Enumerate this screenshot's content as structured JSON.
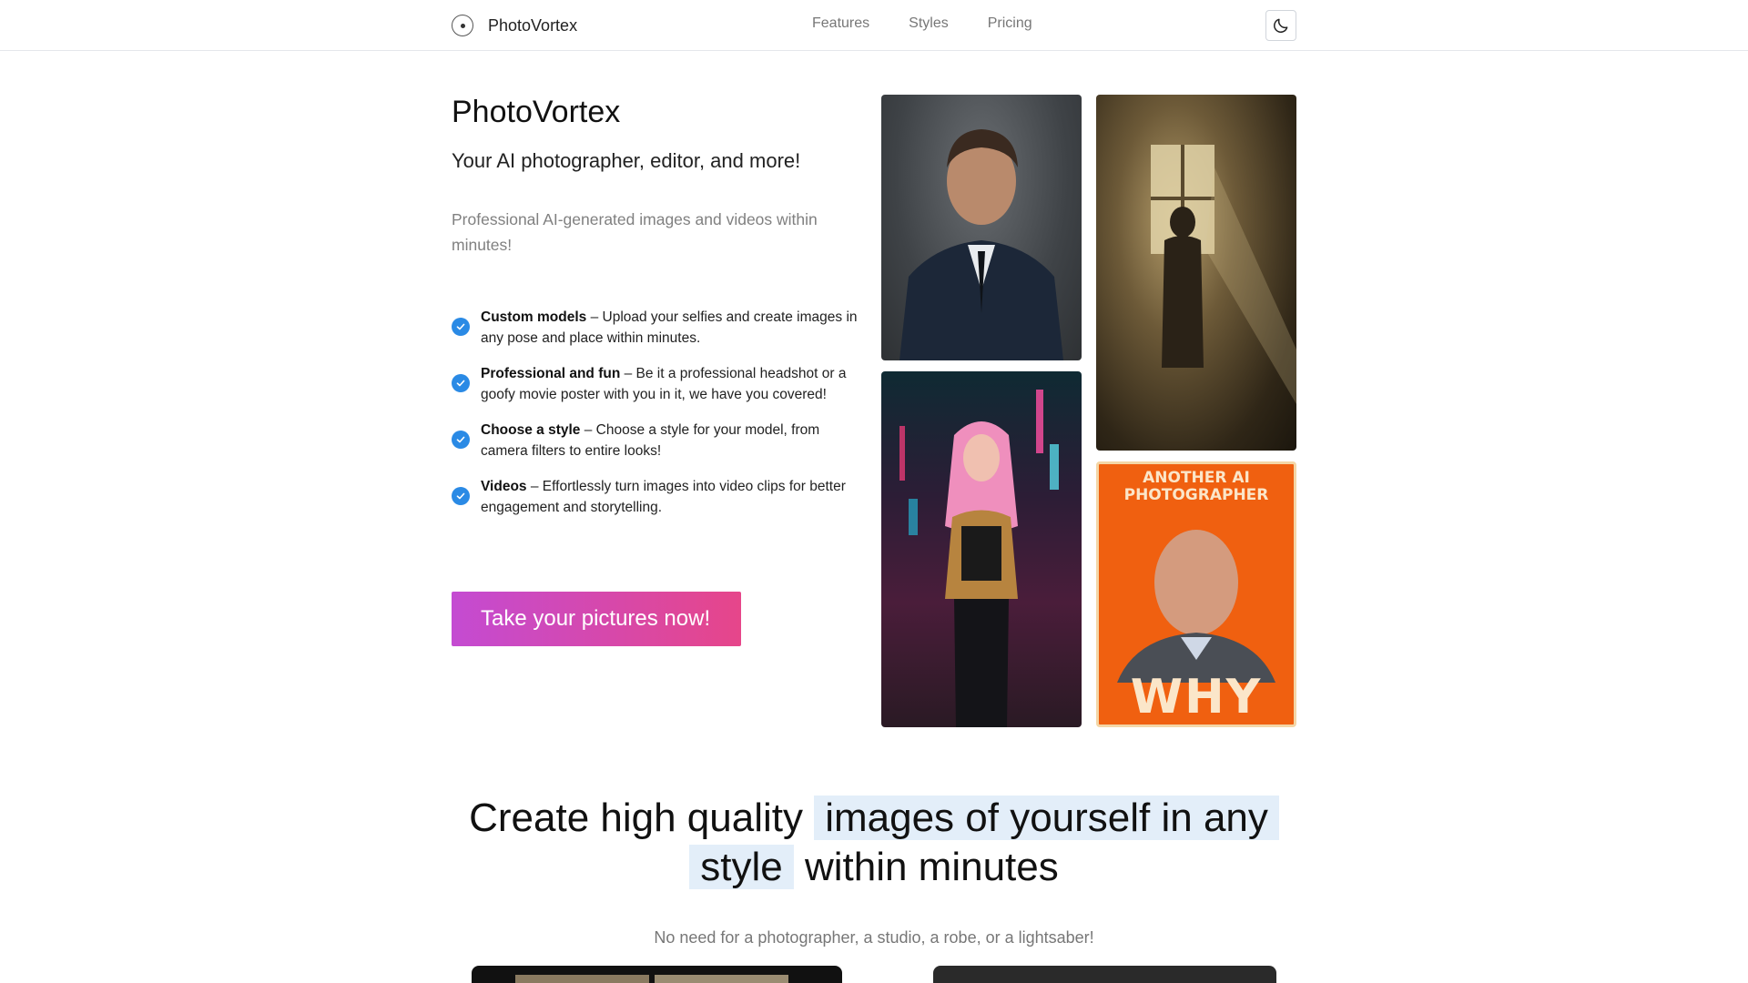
{
  "nav": {
    "brand": "PhotoVortex",
    "links": [
      "Features",
      "Styles",
      "Pricing"
    ]
  },
  "hero": {
    "title": "PhotoVortex",
    "subtitle": "Your AI photographer, editor, and more!",
    "description": "Professional AI-generated images and videos within minutes!",
    "features": [
      {
        "title": "Custom models",
        "text": " – Upload your selfies and create images in any pose and place within minutes."
      },
      {
        "title": "Professional and fun",
        "text": " – Be it a professional headshot or a goofy movie poster with you in it, we have you covered!"
      },
      {
        "title": "Choose a style",
        "text": " – Choose a style for your model, from camera filters to entire looks!"
      },
      {
        "title": "Videos",
        "text": " – Effortlessly turn images into video clips for better engagement and storytelling."
      }
    ],
    "cta": "Take your pictures now!",
    "poster": {
      "headline_line1": "ANOTHER AI",
      "headline_line2": "PHOTOGRAPHER",
      "word": "WHY"
    }
  },
  "section": {
    "title_part1": "Create high quality",
    "title_highlight1": "images of yourself in any",
    "title_highlight2": "style",
    "title_part2": "within minutes",
    "subtitle": "No need for a photographer, a studio, a robe, or a lightsaber!"
  },
  "colors": {
    "accent_check": "#2a8ae5",
    "cta_gradient_start": "#c44bd2",
    "cta_gradient_end": "#e6468a",
    "highlight_bg": "#e3eef9"
  }
}
